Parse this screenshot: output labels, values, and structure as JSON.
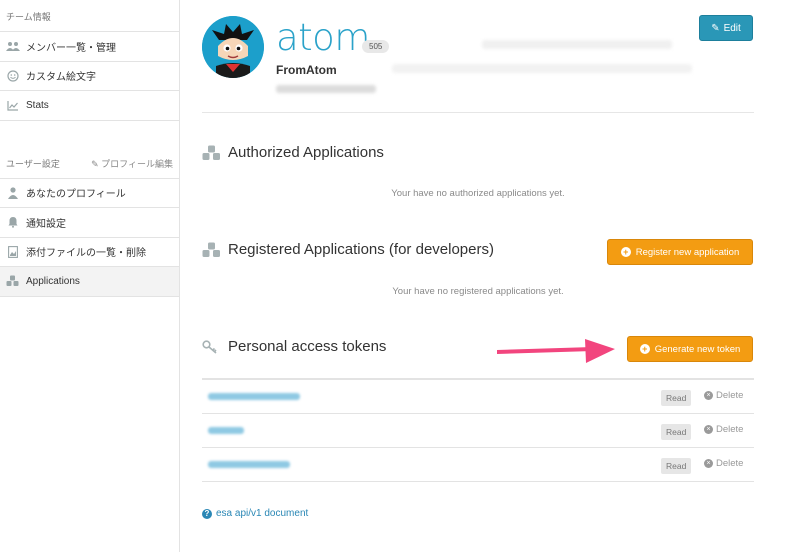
{
  "sidebar": {
    "team_header": "チーム情報",
    "team_items": [
      {
        "label": "メンバー一覧・管理",
        "icon": "users-icon"
      },
      {
        "label": "カスタム絵文字",
        "icon": "smiley-icon"
      },
      {
        "label": "Stats",
        "icon": "chart-icon"
      }
    ],
    "user_header": "ユーザー設定",
    "user_edit_label": "プロフィール編集",
    "user_items": [
      {
        "label": "あなたのプロフィール",
        "icon": "user-icon"
      },
      {
        "label": "通知設定",
        "icon": "bell-icon"
      },
      {
        "label": "添付ファイルの一覧・削除",
        "icon": "image-icon"
      },
      {
        "label": "Applications",
        "icon": "cubes-icon",
        "active": true
      }
    ]
  },
  "profile": {
    "name": "atom",
    "count": "505",
    "screen_name": "FromAtom",
    "edit_label": "Edit"
  },
  "authorized": {
    "title": "Authorized Applications",
    "empty": "Your have no authorized applications yet."
  },
  "registered": {
    "title": "Registered Applications (for developers)",
    "button": "Register new application",
    "empty": "Your have no registered applications yet."
  },
  "tokens": {
    "title": "Personal access tokens",
    "button": "Generate new token",
    "rows": [
      {
        "scope": "Read",
        "delete": "Delete"
      },
      {
        "scope": "Read",
        "delete": "Delete"
      },
      {
        "scope": "Read",
        "delete": "Delete"
      }
    ]
  },
  "doc_link": "esa api/v1 document",
  "colors": {
    "accent": "#2aa2c9",
    "orange": "#f39c12",
    "arrow": "#f2457e"
  }
}
